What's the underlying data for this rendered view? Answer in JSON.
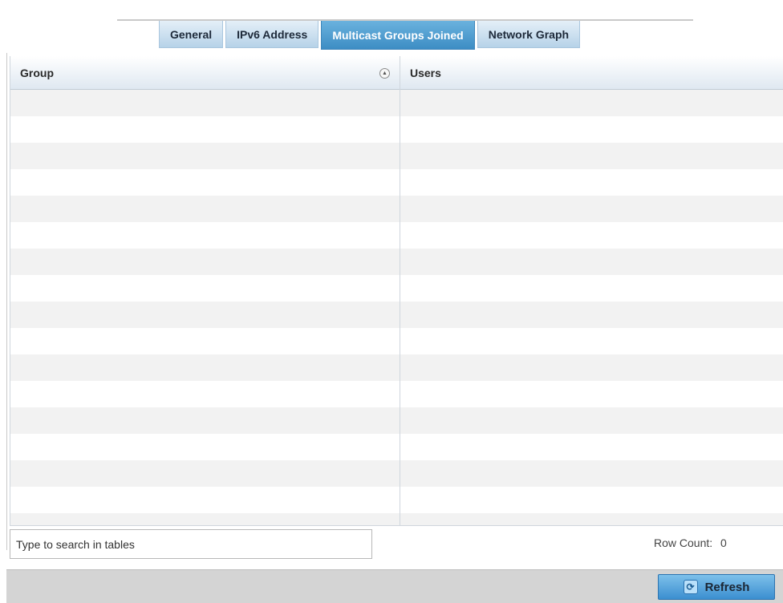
{
  "tabs": [
    {
      "label": "General",
      "active": false
    },
    {
      "label": "IPv6 Address",
      "active": false
    },
    {
      "label": "Multicast Groups Joined",
      "active": true
    },
    {
      "label": "Network Graph",
      "active": false
    }
  ],
  "table": {
    "columns": [
      {
        "label": "Group",
        "sort": "ascending",
        "sort_icon": "sort-ascending-icon"
      },
      {
        "label": "Users"
      }
    ],
    "rows": []
  },
  "search": {
    "placeholder": "Type to search in tables",
    "value": ""
  },
  "row_count": {
    "label": "Row Count:",
    "value": "0"
  },
  "footer": {
    "refresh_label": "Refresh",
    "refresh_icon": "refresh-icon"
  },
  "colors": {
    "active_tab": "#3d8dc4",
    "tab": "#b6d2e8",
    "footer": "#d4d4d4",
    "button": "#3b8fd0"
  }
}
